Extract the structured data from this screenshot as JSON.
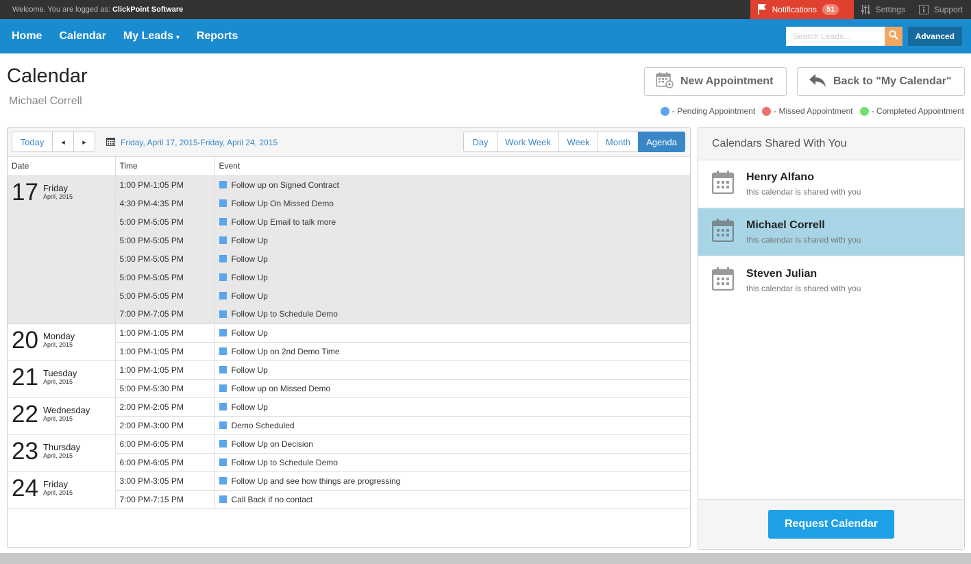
{
  "topbar": {
    "welcome_text": "Welcome. You are logged as:",
    "company": "ClickPoint Software",
    "notifications_label": "Notifications",
    "notifications_count": "51",
    "settings_label": "Settings",
    "support_label": "Support"
  },
  "nav": {
    "home": "Home",
    "calendar": "Calendar",
    "my_leads": "My Leads",
    "reports": "Reports",
    "search_placeholder": "Search Leads...",
    "advanced": "Advanced"
  },
  "header": {
    "title": "Calendar",
    "user": "Michael Correll",
    "new_appointment": "New Appointment",
    "back_to_calendar": "Back to \"My Calendar\""
  },
  "legend": {
    "pending": "- Pending Appointment",
    "missed": "- Missed Appointment",
    "completed": "- Completed Appointment",
    "pending_color": "#5aa5ec",
    "missed_color": "#f07070",
    "completed_color": "#70e070"
  },
  "toolbar": {
    "today": "Today",
    "prev": "◂",
    "next": "▸",
    "date_range": "Friday, April 17, 2015-Friday, April 24, 2015",
    "views": [
      "Day",
      "Work Week",
      "Week",
      "Month",
      "Agenda"
    ],
    "active_view": "Agenda"
  },
  "agenda": {
    "headers": {
      "date": "Date",
      "time": "Time",
      "event": "Event"
    },
    "days": [
      {
        "num": "17",
        "name": "Friday",
        "month": "April, 2015",
        "events": [
          {
            "time": "1:00 PM-1:05 PM",
            "title": "Follow up on Signed Contract"
          },
          {
            "time": "4:30 PM-4:35 PM",
            "title": "Follow Up On Missed Demo"
          },
          {
            "time": "5:00 PM-5:05 PM",
            "title": "Follow Up Email to talk more"
          },
          {
            "time": "5:00 PM-5:05 PM",
            "title": "Follow Up"
          },
          {
            "time": "5:00 PM-5:05 PM",
            "title": "Follow Up"
          },
          {
            "time": "5:00 PM-5:05 PM",
            "title": "Follow Up"
          },
          {
            "time": "5:00 PM-5:05 PM",
            "title": "Follow Up"
          },
          {
            "time": "7:00 PM-7:05 PM",
            "title": "Follow Up to Schedule Demo"
          }
        ]
      },
      {
        "num": "20",
        "name": "Monday",
        "month": "April, 2015",
        "events": [
          {
            "time": "1:00 PM-1:05 PM",
            "title": "Follow Up"
          },
          {
            "time": "1:00 PM-1:05 PM",
            "title": "Follow Up on 2nd Demo Time"
          }
        ]
      },
      {
        "num": "21",
        "name": "Tuesday",
        "month": "April, 2015",
        "events": [
          {
            "time": "1:00 PM-1:05 PM",
            "title": "Follow Up"
          },
          {
            "time": "5:00 PM-5:30 PM",
            "title": "Follow up on Missed Demo"
          }
        ]
      },
      {
        "num": "22",
        "name": "Wednesday",
        "month": "April, 2015",
        "events": [
          {
            "time": "2:00 PM-2:05 PM",
            "title": "Follow Up"
          },
          {
            "time": "2:00 PM-3:00 PM",
            "title": "Demo Scheduled"
          }
        ]
      },
      {
        "num": "23",
        "name": "Thursday",
        "month": "April, 2015",
        "events": [
          {
            "time": "6:00 PM-6:05 PM",
            "title": "Follow Up on Decision"
          },
          {
            "time": "6:00 PM-6:05 PM",
            "title": "Follow Up to Schedule Demo"
          }
        ]
      },
      {
        "num": "24",
        "name": "Friday",
        "month": "April, 2015",
        "events": [
          {
            "time": "3:00 PM-3:05 PM",
            "title": "Follow Up and see how things are progressing"
          },
          {
            "time": "7:00 PM-7:15 PM",
            "title": "Call Back if no contact"
          }
        ]
      }
    ]
  },
  "shared": {
    "title": "Calendars Shared With You",
    "items": [
      {
        "name": "Henry Alfano",
        "desc": "this calendar is shared with you",
        "selected": false
      },
      {
        "name": "Michael Correll",
        "desc": "this calendar is shared with you",
        "selected": true
      },
      {
        "name": "Steven Julian",
        "desc": "this calendar is shared with you",
        "selected": false
      }
    ],
    "request_button": "Request Calendar"
  }
}
